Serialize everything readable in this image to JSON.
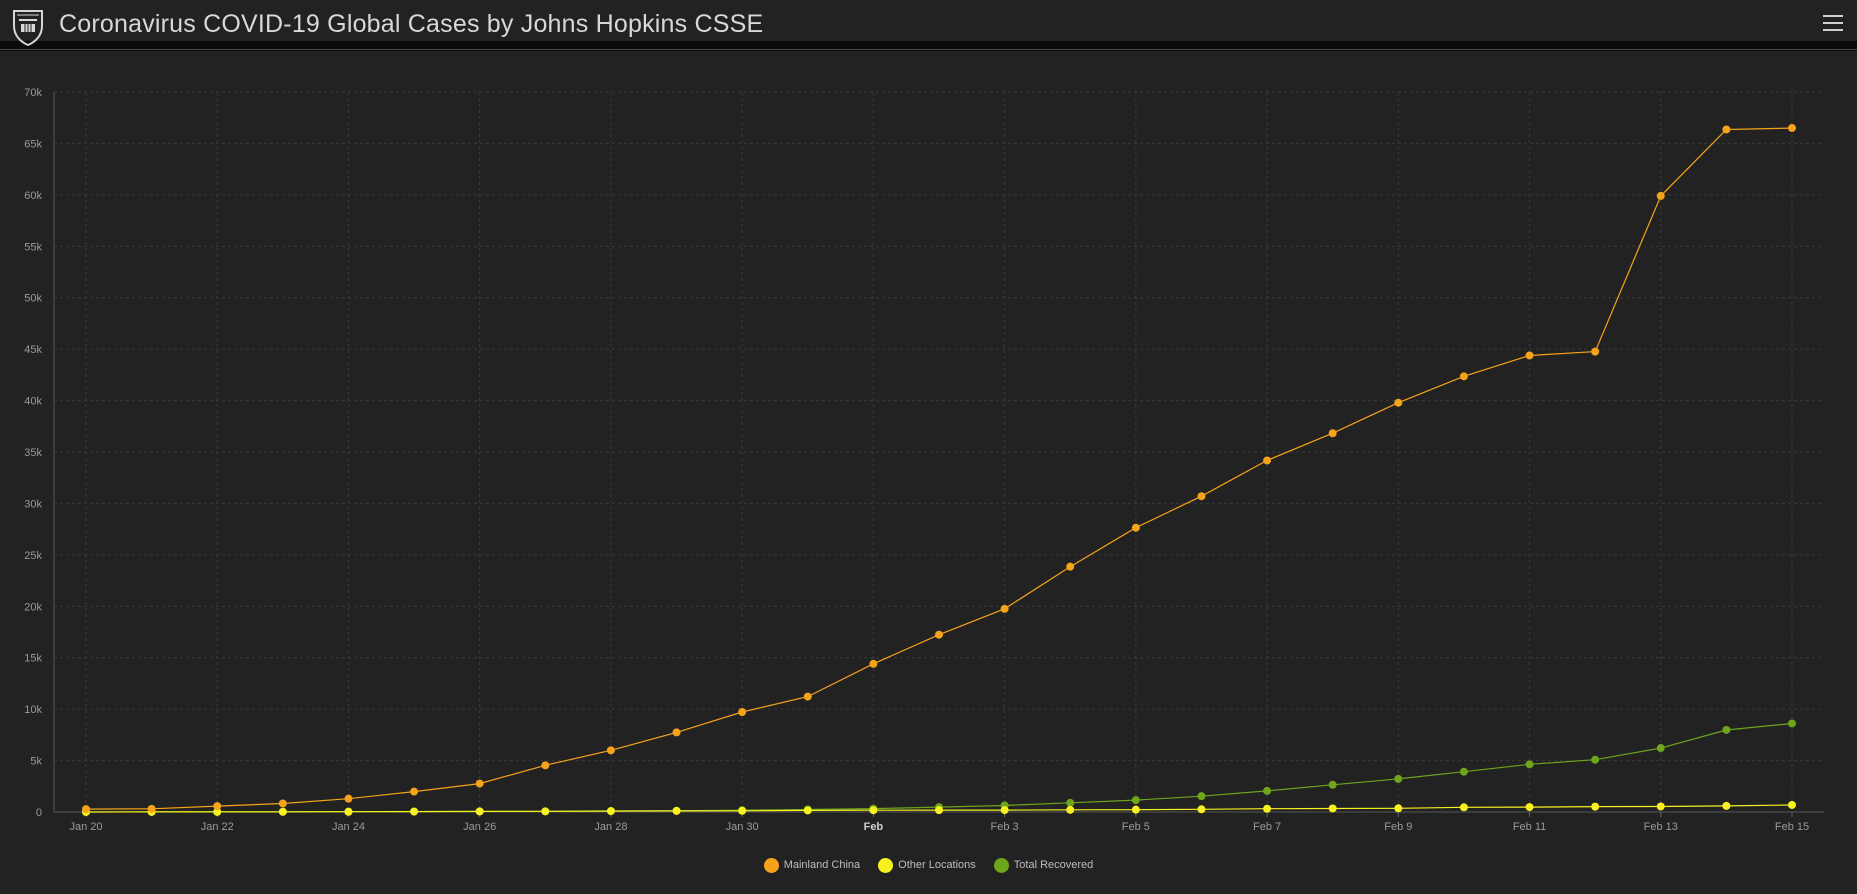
{
  "header": {
    "title": "Coronavirus COVID-19 Global Cases by Johns Hopkins CSSE",
    "logo_icon": "jhu-shield-icon",
    "menu_icon": "hamburger-menu-icon"
  },
  "colors": {
    "background": "#222222",
    "mainland": "#f5a31a",
    "other": "#f7f21f",
    "recovered": "#6ea51c",
    "grid": "#3a3a3a"
  },
  "chart_data": {
    "type": "line",
    "x": [
      "Jan 20",
      "Jan 21",
      "Jan 22",
      "Jan 23",
      "Jan 24",
      "Jan 25",
      "Jan 26",
      "Jan 27",
      "Jan 28",
      "Jan 29",
      "Jan 30",
      "Jan 31",
      "Feb 1",
      "Feb 2",
      "Feb 3",
      "Feb 4",
      "Feb 5",
      "Feb 6",
      "Feb 7",
      "Feb 8",
      "Feb 9",
      "Feb 10",
      "Feb 11",
      "Feb 12",
      "Feb 13",
      "Feb 14",
      "Feb 15"
    ],
    "x_ticks": [
      "Jan 20",
      "Jan 22",
      "Jan 24",
      "Jan 26",
      "Jan 28",
      "Jan 30",
      "Feb",
      "Feb 3",
      "Feb 5",
      "Feb 7",
      "Feb 9",
      "Feb 11",
      "Feb 13",
      "Feb 15"
    ],
    "y_ticks": [
      "0",
      "5k",
      "10k",
      "15k",
      "20k",
      "25k",
      "30k",
      "35k",
      "40k",
      "45k",
      "50k",
      "55k",
      "60k",
      "65k",
      "70k"
    ],
    "ylim": [
      0,
      70000
    ],
    "grid": true,
    "legend_position": "bottom-center",
    "series": [
      {
        "name": "Mainland China",
        "values": [
          278,
          309,
          571,
          830,
          1297,
          1985,
          2761,
          4537,
          5997,
          7736,
          9720,
          11221,
          14411,
          17238,
          19752,
          23850,
          27638,
          30702,
          34179,
          36823,
          39794,
          42355,
          44386,
          44759,
          59895,
          66358,
          66495
        ]
      },
      {
        "name": "Other Locations",
        "values": [
          4,
          6,
          8,
          14,
          25,
          40,
          57,
          64,
          87,
          105,
          118,
          153,
          173,
          183,
          188,
          212,
          227,
          265,
          317,
          343,
          361,
          457,
          476,
          523,
          538,
          595,
          685
        ]
      },
      {
        "name": "Total Recovered",
        "values": [
          0,
          28,
          28,
          34,
          38,
          49,
          51,
          60,
          103,
          124,
          171,
          243,
          328,
          475,
          632,
          892,
          1153,
          1540,
          2050,
          2649,
          3219,
          3918,
          4636,
          5082,
          6217,
          7977,
          8608
        ]
      }
    ]
  }
}
